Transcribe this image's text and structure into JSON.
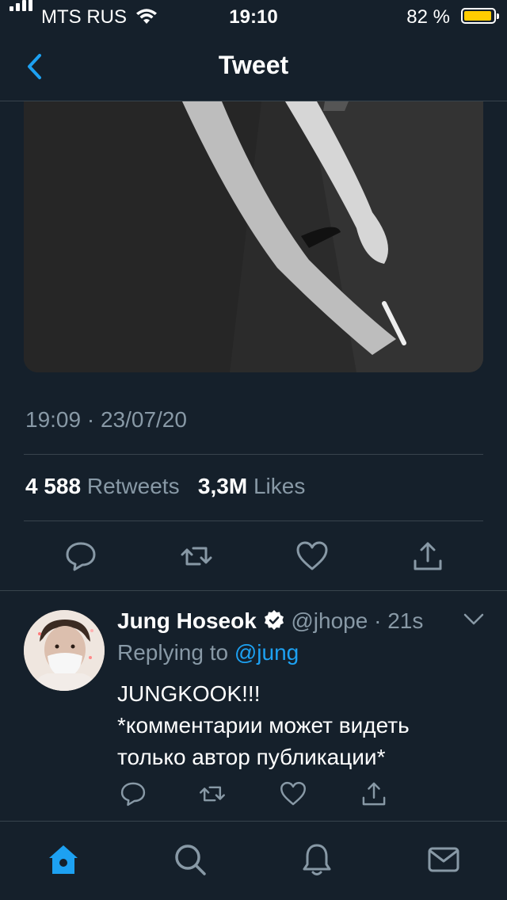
{
  "status_bar": {
    "carrier": "MTS RUS",
    "time": "19:10",
    "battery_percent": "82 %",
    "battery_color": "#ffcc00"
  },
  "header": {
    "title": "Tweet",
    "back_icon": "chevron-left-icon"
  },
  "tweet": {
    "timestamp": "19:09 · 23/07/20",
    "retweets_count": "4 588",
    "retweets_label": "Retweets",
    "likes_count": "3,3M",
    "likes_label": "Likes",
    "actions": [
      "reply-icon",
      "retweet-icon",
      "like-icon",
      "share-icon"
    ]
  },
  "reply": {
    "name": "Jung Hoseok",
    "handle": "@jhope",
    "time": "21s",
    "replying_prefix": "Replying to",
    "replying_mention": "@jung",
    "text_line1": "JUNGKOOK!!!",
    "text_line2": "*комментарии может видеть",
    "text_line3": "только автор публикации*"
  },
  "tabbar": {
    "items": [
      "home-icon",
      "search-icon",
      "notifications-icon",
      "messages-icon"
    ]
  },
  "colors": {
    "background": "#15202b",
    "accent": "#1da1f2",
    "secondary_text": "#8899a6",
    "divider": "#38444d"
  }
}
